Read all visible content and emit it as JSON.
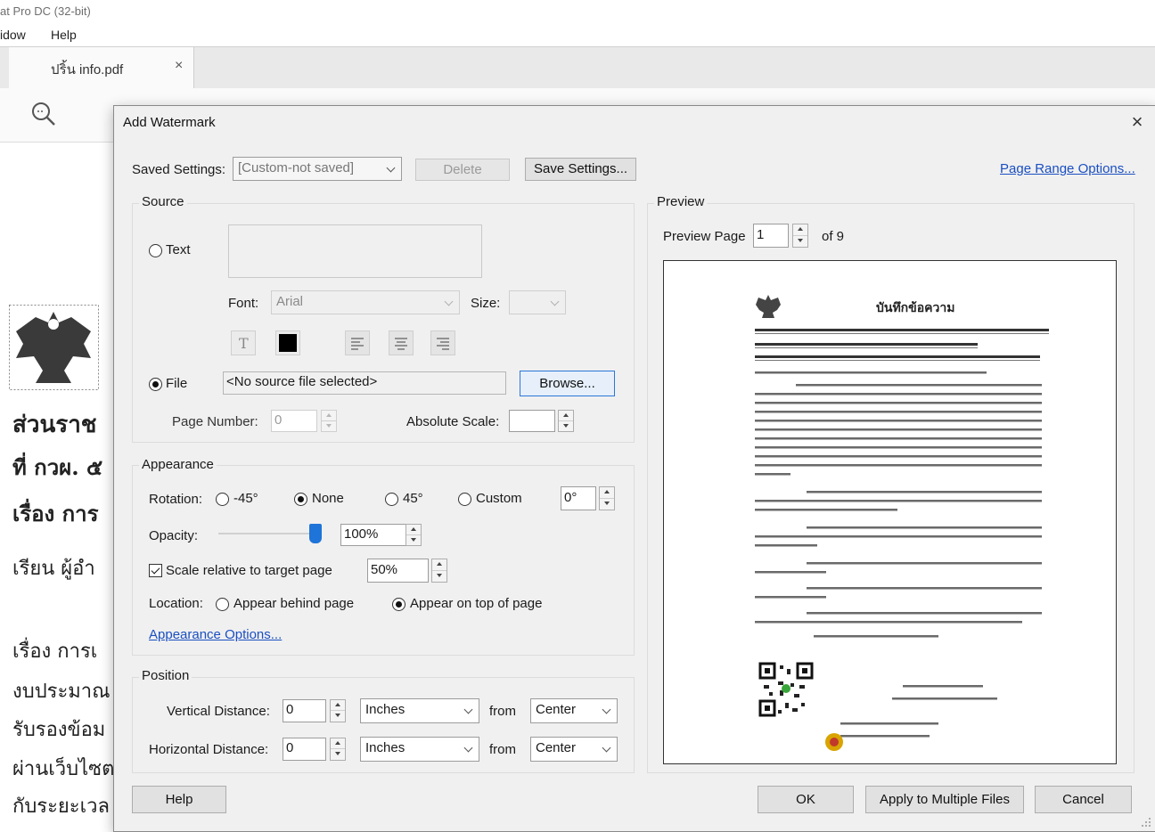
{
  "app": {
    "title": "at Pro DC (32-bit)",
    "menu": [
      "idow",
      "Help"
    ],
    "tab_label": "ปริ้น info.pdf",
    "tab_close": "×"
  },
  "background_doc": {
    "lines": [
      "ส่วนราช",
      "ที่  กวผ. ๕",
      "เรื่อง  การ",
      "เรียน  ผู้อำ",
      "เรื่อง  การเ",
      "งบประมาณ",
      "รับรองข้อม",
      "ผ่านเว็บไซต",
      "กับระยะเวล"
    ]
  },
  "dialog": {
    "title": "Add Watermark",
    "close": "×",
    "saved_settings_label": "Saved Settings:",
    "saved_settings_value": "[Custom-not saved]",
    "delete_btn": "Delete",
    "save_settings_btn": "Save Settings...",
    "page_range_link": "Page Range Options...",
    "source": {
      "group_label": "Source",
      "text_radio": "Text",
      "font_label": "Font:",
      "font_value": "Arial",
      "size_label": "Size:",
      "size_value": "",
      "file_radio": "File",
      "file_value": "<No source file selected>",
      "browse_btn": "Browse...",
      "page_number_label": "Page Number:",
      "page_number_value": "0",
      "absolute_scale_label": "Absolute Scale:",
      "absolute_scale_value": ""
    },
    "appearance": {
      "group_label": "Appearance",
      "rotation_label": "Rotation:",
      "rot_m45": "-45°",
      "rot_none": "None",
      "rot_45": "45°",
      "rot_custom": "Custom",
      "rot_custom_value": "0°",
      "opacity_label": "Opacity:",
      "opacity_value": "100%",
      "opacity_level": 1.0,
      "scale_label": "Scale relative to target page",
      "scale_value": "50%",
      "location_label": "Location:",
      "behind": "Appear behind page",
      "on_top": "Appear on top of page",
      "options_link": "Appearance Options..."
    },
    "position": {
      "group_label": "Position",
      "vertical_label": "Vertical Distance:",
      "vertical_value": "0",
      "vertical_unit": "Inches",
      "vertical_from_label": "from",
      "vertical_from": "Center",
      "horizontal_label": "Horizontal Distance:",
      "horizontal_value": "0",
      "horizontal_unit": "Inches",
      "horizontal_from_label": "from",
      "horizontal_from": "Center"
    },
    "preview": {
      "group_label": "Preview",
      "page_label": "Preview Page",
      "page_value": "1",
      "of_pages": "of 9",
      "doc_title": "บันทึกข้อความ"
    },
    "buttons": {
      "help": "Help",
      "ok": "OK",
      "apply_multi": "Apply to Multiple Files",
      "cancel": "Cancel"
    }
  }
}
